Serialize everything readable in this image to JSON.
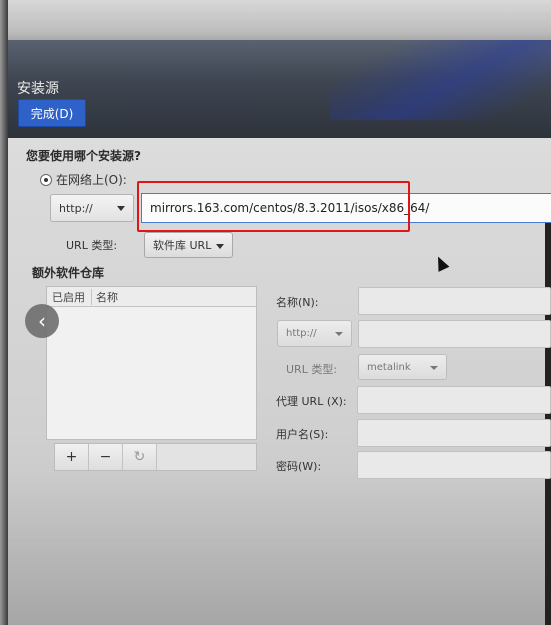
{
  "page": {
    "title": "安装源"
  },
  "header": {
    "done_label": "完成(D)"
  },
  "source": {
    "question": "您要使用哪个安装源?",
    "network_radio_label": "在网络上(O):",
    "protocol_value": "http://",
    "url_value": "mirrors.163.com/centos/8.3.2011/isos/x86_64/",
    "url_type_label": "URL 类型:",
    "url_type_value": "软件库 URL"
  },
  "repos": {
    "heading": "额外软件仓库",
    "columns": {
      "enabled": "已启用",
      "name": "名称"
    },
    "toolbar": {
      "add": "+",
      "remove": "−",
      "refresh": "↻"
    }
  },
  "repo_form": {
    "name_label": "名称(N):",
    "protocol_value": "http://",
    "url_type_label": "URL 类型:",
    "url_type_value": "metalink",
    "proxy_label": "代理 URL (X):",
    "username_label": "用户名(S):",
    "password_label": "密码(W):"
  },
  "colors": {
    "accent": "#2f62c8",
    "highlight": "#e01515"
  }
}
